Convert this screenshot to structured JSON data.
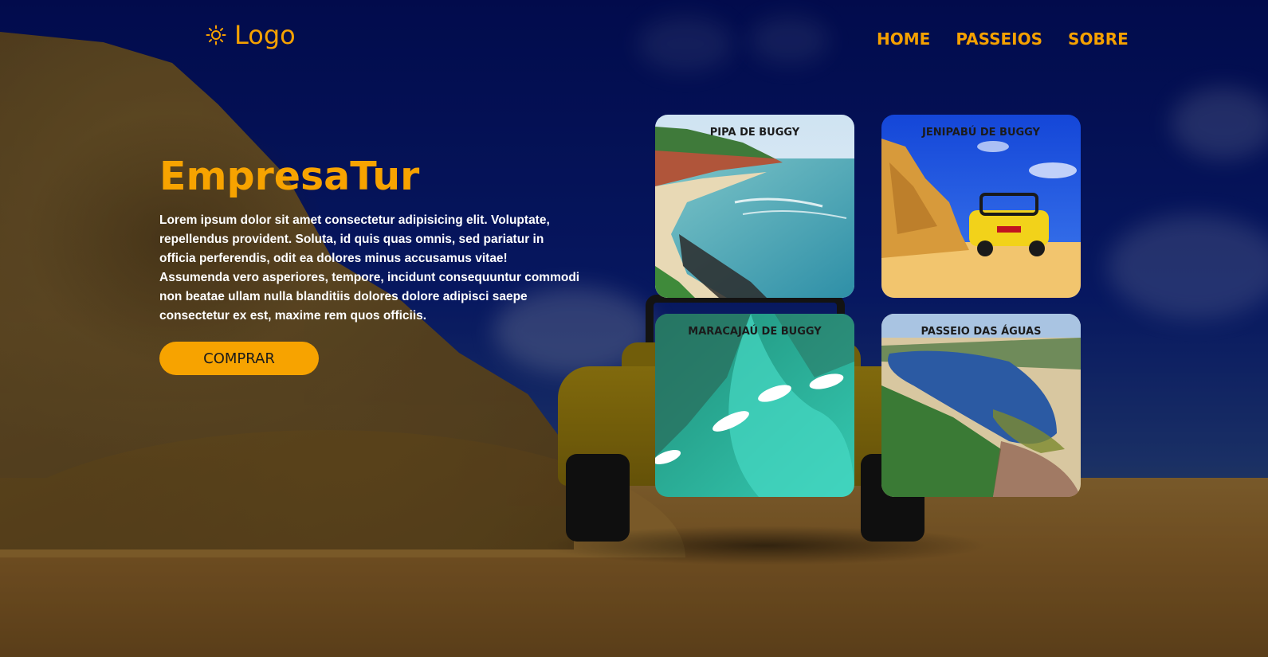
{
  "header": {
    "logo_text": "Logo",
    "logo_icon": "sun-icon",
    "nav": [
      {
        "label": "HOME"
      },
      {
        "label": "PASSEIOS"
      },
      {
        "label": "SOBRE"
      }
    ]
  },
  "hero": {
    "title": "EmpresaTur",
    "text": "Lorem ipsum dolor sit amet consectetur adipisicing elit. Voluptate, repellendus provident. Soluta, id quis quas omnis, sed pariatur in officia perferendis, odit ea dolores minus accusamus vitae! Assumenda vero asperiores, tempore, incidunt consequuntur commodi non beatae ullam nulla blanditiis dolores dolore adipisci saepe consectetur ex est, maxime rem quos officiis.",
    "button_label": "COMPRAR"
  },
  "tours": [
    {
      "title": "PIPA DE BUGGY"
    },
    {
      "title": "JENIPABÚ DE BUGGY"
    },
    {
      "title": "MARACAJAÚ DE BUGGY"
    },
    {
      "title": "PASSEIO DAS ÁGUAS"
    }
  ],
  "colors": {
    "accent": "#f7a300",
    "text": "#ffffff",
    "background": "#0a1a5e"
  }
}
